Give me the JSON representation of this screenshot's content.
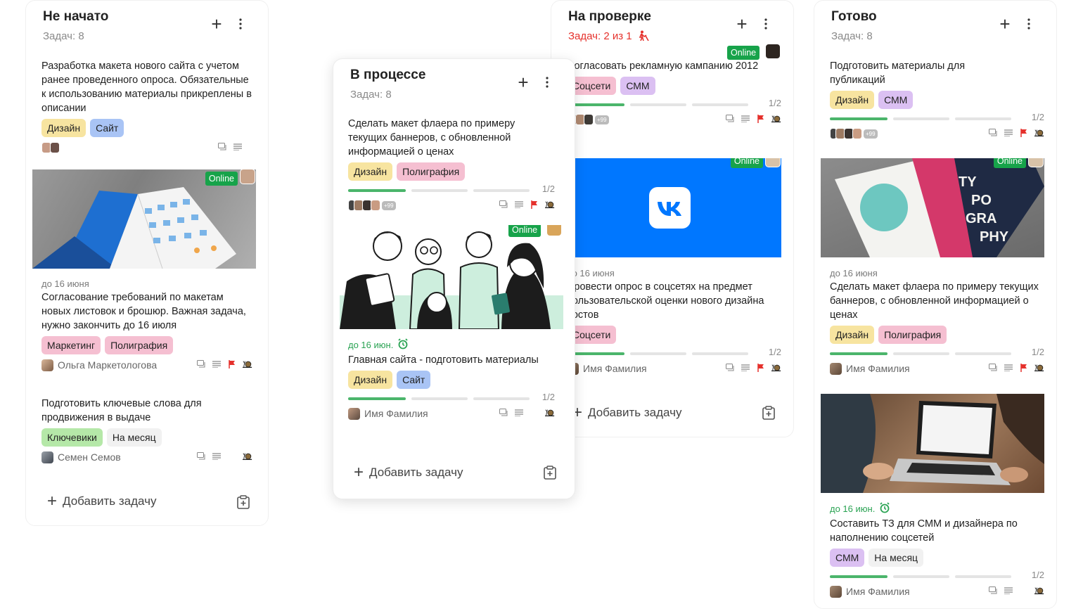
{
  "online_label": "Online",
  "add_task_label": "Добавить задачу",
  "columns": [
    {
      "title": "Не начато",
      "count": "Задач: 8",
      "cards": [
        {
          "desc": "Разработка макета нового сайта с учетом ранее проведенного опроса. Обязательные к использованию материалы прикреплены в описании",
          "tags": [
            "Дизайн",
            "Сайт"
          ]
        },
        {
          "deadline": "до 16 июня",
          "desc": "Согласование требований по макетам новых листовок и брошюр. Важная задача, нужно закончить до 16 июля",
          "tags": [
            "Маркетинг",
            "Полиграфия"
          ],
          "user": "Ольга Маркетологова"
        },
        {
          "desc": "Подготовить ключевые слова для продвижения в выдаче",
          "tags": [
            "Ключевики",
            "На месяц"
          ],
          "user": "Семен Семов"
        }
      ]
    },
    {
      "title": "В процессе",
      "count": "Задач: 8",
      "cards": [
        {
          "desc": "Сделать макет флаера по примеру текущих баннеров, с обновленной информацией о ценах",
          "tags": [
            "Дизайн",
            "Полиграфия"
          ],
          "progress": "1/2",
          "more": "+99"
        },
        {
          "deadline": "до 16 июн.",
          "desc": "Главная сайта - подготовить материалы",
          "tags": [
            "Дизайн",
            "Сайт"
          ],
          "progress": "1/2",
          "user": "Имя Фамилия"
        }
      ]
    },
    {
      "title": "На проверке",
      "count": "Задач: 2 из 1",
      "cards": [
        {
          "desc": "Согласовать рекламную кампанию 2012",
          "tags": [
            "Соцсети",
            "СММ"
          ],
          "progress": "1/2",
          "more": "+99"
        },
        {
          "deadline": "до 16 июня",
          "desc": "Провести опрос в соцсетях на предмет пользовательской оценки нового дизайна постов",
          "tags": [
            "Соцсети"
          ],
          "progress": "1/2",
          "user": "Имя Фамилия"
        }
      ]
    },
    {
      "title": "Готово",
      "count": "Задач: 8",
      "cards": [
        {
          "desc": "Подготовить материалы для публикаций",
          "tags": [
            "Дизайн",
            "СММ"
          ],
          "progress": "1/2",
          "more": "+99"
        },
        {
          "deadline": "до 16 июня",
          "desc": "Сделать макет флаера по примеру текущих баннеров, с обновленной информацией о ценах",
          "tags": [
            "Дизайн",
            "Полиграфия"
          ],
          "progress": "1/2",
          "user": "Имя Фамилия"
        },
        {
          "deadline": "до 16 июн.",
          "desc": "Составить ТЗ для СММ и дизайнера по наполнению соцсетей",
          "tags": [
            "СММ",
            "На месяц"
          ],
          "progress": "1/2",
          "user": "Имя Фамилия"
        }
      ]
    }
  ],
  "colors": {
    "online": "#17a34a",
    "progress": "#4bb56b",
    "alert": "#e5312c",
    "vk": "#0077ff"
  },
  "icons": [
    "plus-icon",
    "kebab-menu-icon",
    "comment-icon",
    "description-icon",
    "flag-icon",
    "snail-icon",
    "alarm-icon",
    "clipboard-add-icon",
    "worker-icon"
  ]
}
